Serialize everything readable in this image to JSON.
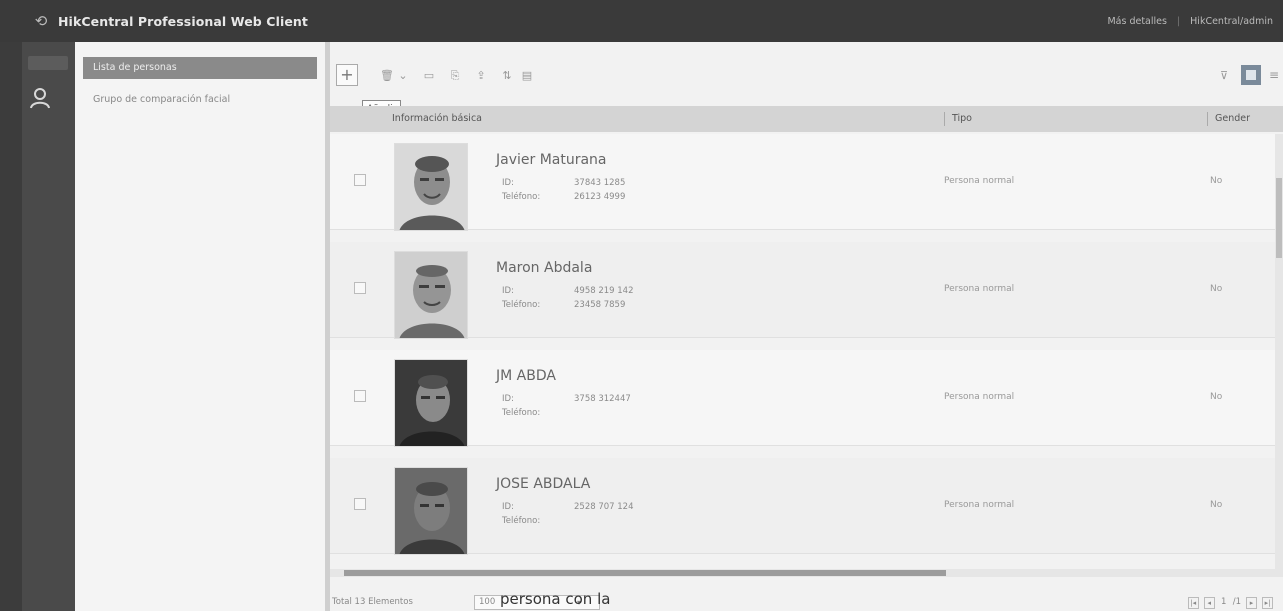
{
  "app": {
    "title": "HikCentral Professional Web Client",
    "user_text": "Más detalles",
    "host_text": "HikCentral/admin"
  },
  "tree": {
    "active_item": "Lista de personas",
    "items": [
      "Grupo de comparación facial"
    ]
  },
  "toolbar": {
    "add_label": "+",
    "tooltip": "Añadir"
  },
  "table": {
    "columns": [
      "Información básica",
      "Tipo",
      "Gender"
    ],
    "id_label": "ID:",
    "phone_label": "Teléfono:",
    "rows": [
      {
        "name": "Javier Maturana",
        "id": "37843 1285",
        "phone": "26123 4999",
        "tipo": "Persona normal",
        "gender": "No"
      },
      {
        "name": "Maron Abdala",
        "id": "4958 219 142",
        "phone": "23458 7859",
        "tipo": "Persona normal",
        "gender": "No"
      },
      {
        "name": "JM ABDA",
        "id": "3758 312447",
        "phone": "",
        "tipo": "Persona normal",
        "gender": "No"
      },
      {
        "name": "JOSE ABDALA",
        "id": "2528 707 124",
        "phone": "",
        "tipo": "Persona normal",
        "gender": "No"
      }
    ]
  },
  "footer": {
    "total": "Total 13 Elementos",
    "page_size": "100",
    "pages": [
      "1",
      "/1"
    ]
  },
  "document": {
    "fragment_left": "persona con la",
    "fragment_right": ""
  },
  "colors": {
    "topbar": "#3a3a3a",
    "sidebar": "#4a4a4a",
    "active_item": "#8a8a8a"
  }
}
